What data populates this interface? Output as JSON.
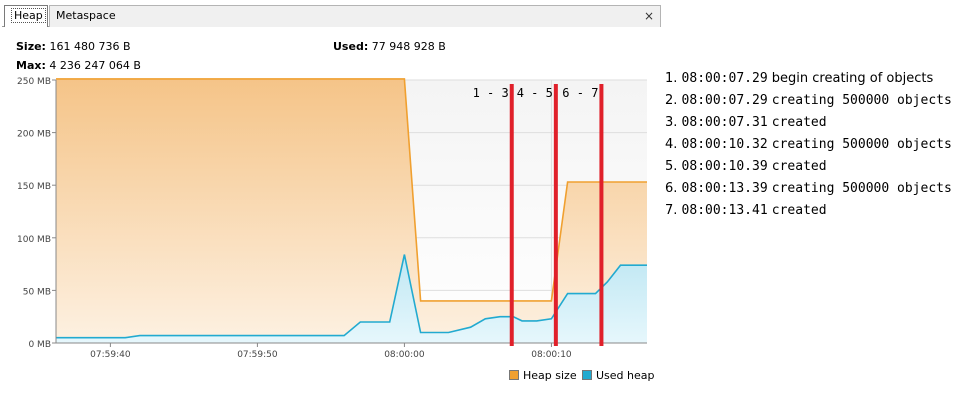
{
  "tabs": [
    {
      "label": "Heap",
      "active": true
    },
    {
      "label": "Metaspace",
      "active": false
    }
  ],
  "close_icon": "×",
  "stats": {
    "size_label": "Size:",
    "size_value": "161 480 736 B",
    "used_label": "Used:",
    "used_value": "77 948 928 B",
    "max_label": "Max:",
    "max_value": "4 236 247 064 B"
  },
  "colors": {
    "heap_line": "#f0a030",
    "used_line": "#22aad0",
    "marker": "#e0202a"
  },
  "chart_data": {
    "type": "area",
    "y_ticks": [
      "0 MB",
      "50 MB",
      "100 MB",
      "150 MB",
      "200 MB",
      "250 MB"
    ],
    "ylim": [
      0,
      250
    ],
    "x_ticks": [
      {
        "label": "07:59:40",
        "t": 10
      },
      {
        "label": "07:59:50",
        "t": 20
      },
      {
        "label": "08:00:00",
        "t": 30
      },
      {
        "label": "08:00:10",
        "t": 40
      }
    ],
    "xlim": [
      6.3,
      46.5
    ],
    "series": [
      {
        "name": "Heap size",
        "color": "#f0a030",
        "points": [
          [
            6.3,
            251
          ],
          [
            30,
            251
          ],
          [
            31.1,
            40
          ],
          [
            40,
            40
          ],
          [
            41.1,
            153
          ],
          [
            46.5,
            153
          ]
        ]
      },
      {
        "name": "Used heap",
        "color": "#22aad0",
        "points": [
          [
            6.3,
            5
          ],
          [
            11,
            5
          ],
          [
            12,
            7
          ],
          [
            25.9,
            7
          ],
          [
            27,
            20
          ],
          [
            29,
            20
          ],
          [
            30,
            84
          ],
          [
            31.1,
            10
          ],
          [
            33,
            10
          ],
          [
            34.5,
            15
          ],
          [
            35.5,
            23
          ],
          [
            36.5,
            25
          ],
          [
            37.4,
            25
          ],
          [
            38,
            21
          ],
          [
            39,
            21
          ],
          [
            40,
            23
          ],
          [
            41.1,
            47
          ],
          [
            43,
            47
          ],
          [
            43.8,
            58
          ],
          [
            44.7,
            74
          ],
          [
            46.5,
            74
          ]
        ]
      }
    ],
    "markers": [
      {
        "label": "1 - 3",
        "t": 37.3
      },
      {
        "label": "4 - 5",
        "t": 40.3
      },
      {
        "label": "6 - 7",
        "t": 43.4
      }
    ]
  },
  "legend": [
    {
      "label": "Heap size",
      "color": "#f0a030"
    },
    {
      "label": "Used heap",
      "color": "#22aad0"
    }
  ],
  "log": [
    {
      "num": "1.",
      "time": "08:00:07.29",
      "msg": "begin creating of objects",
      "mono": false
    },
    {
      "num": "2.",
      "time": "08:00:07.29",
      "msg": "creating 500000 objects",
      "mono": true
    },
    {
      "num": "3.",
      "time": "08:00:07.31",
      "msg": "created",
      "mono": true
    },
    {
      "num": "4.",
      "time": "08:00:10.32",
      "msg": "creating 500000 objects",
      "mono": true
    },
    {
      "num": "5.",
      "time": "08:00:10.39",
      "msg": "created",
      "mono": true
    },
    {
      "num": "6.",
      "time": "08:00:13.39",
      "msg": "creating 500000 objects",
      "mono": true
    },
    {
      "num": "7.",
      "time": "08:00:13.41",
      "msg": "created",
      "mono": true
    }
  ]
}
